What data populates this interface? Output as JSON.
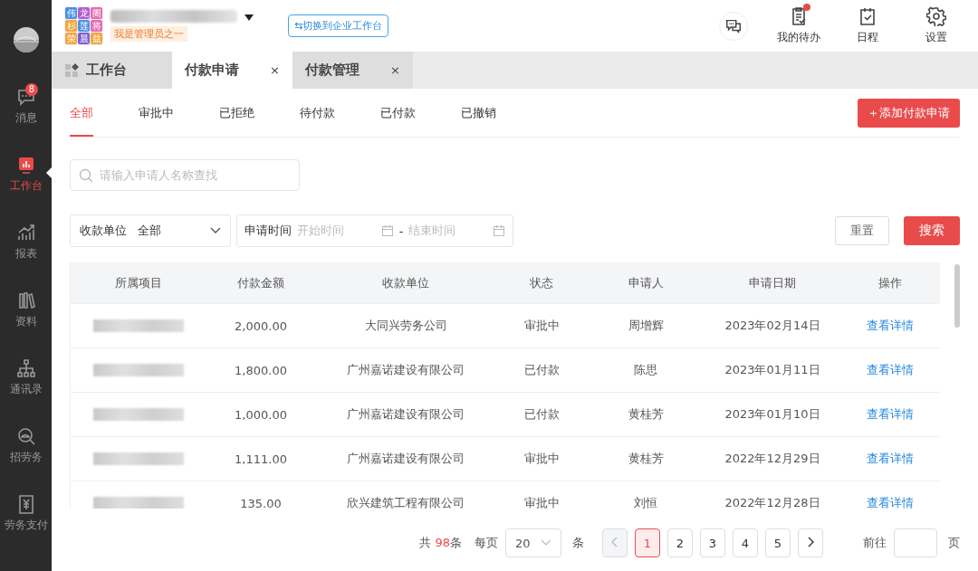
{
  "sidebar": {
    "items": [
      {
        "label": "消息",
        "badge": "8",
        "selected": false
      },
      {
        "label": "工作台",
        "selected": true
      },
      {
        "label": "报表",
        "selected": false
      },
      {
        "label": "资料",
        "selected": false
      },
      {
        "label": "通讯录",
        "selected": false
      },
      {
        "label": "招劳务",
        "selected": false
      },
      {
        "label": "劳务支付",
        "selected": false
      }
    ]
  },
  "header": {
    "logo_chars": [
      "伟",
      "龙",
      "阁",
      "杉",
      "莲",
      "将",
      "荣",
      "晨",
      "益"
    ],
    "role_badge": "我是管理员之一",
    "switch_button": "⇆切换到企业工作台",
    "actions": [
      {
        "kind": "chat"
      },
      {
        "kind": "todo",
        "label": "我的待办",
        "notify": true
      },
      {
        "kind": "calendar",
        "label": "日程",
        "notify": false
      },
      {
        "kind": "gear",
        "label": "设置",
        "notify": false
      }
    ]
  },
  "page_tabs": [
    {
      "label": "工作台",
      "kind": "home",
      "selected": false
    },
    {
      "label": "付款申请",
      "kind": "closable",
      "close": "×",
      "selected": true
    },
    {
      "label": "付款管理",
      "kind": "closable",
      "close": "×",
      "selected": false
    }
  ],
  "status_tabs": [
    {
      "label": "全部",
      "selected": true
    },
    {
      "label": "审批中",
      "selected": false
    },
    {
      "label": "已拒绝",
      "selected": false
    },
    {
      "label": "待付款",
      "selected": false
    },
    {
      "label": "已付款",
      "selected": false
    },
    {
      "label": "已撤销",
      "selected": false
    }
  ],
  "add_button": "＋添加付款申请",
  "search": {
    "placeholder": "请输入申请人名称查找"
  },
  "filters": {
    "payee": {
      "label": "收款单位",
      "value": "全部"
    },
    "date": {
      "label": "申请时间",
      "start_placeholder": "开始时间",
      "separator": "-",
      "end_placeholder": "结束时间"
    },
    "reset": "重置",
    "search": "搜索"
  },
  "table": {
    "columns": [
      "所属项目",
      "付款金额",
      "收款单位",
      "状态",
      "申请人",
      "申请日期",
      "操作"
    ],
    "rows": [
      {
        "amount": "2,000.00",
        "payee": "大同兴劳务公司",
        "status": "审批中",
        "applicant": "周增辉",
        "date": "2023年02月14日",
        "action": "查看详情"
      },
      {
        "amount": "1,800.00",
        "payee": "广州嘉诺建设有限公司",
        "status": "已付款",
        "applicant": "陈思",
        "date": "2023年01月11日",
        "action": "查看详情"
      },
      {
        "amount": "1,000.00",
        "payee": "广州嘉诺建设有限公司",
        "status": "已付款",
        "applicant": "黄桂芳",
        "date": "2023年01月10日",
        "action": "查看详情"
      },
      {
        "amount": "1,111.00",
        "payee": "广州嘉诺建设有限公司",
        "status": "审批中",
        "applicant": "黄桂芳",
        "date": "2022年12月29日",
        "action": "查看详情"
      },
      {
        "amount": "135.00",
        "payee": "欣兴建筑工程有限公司",
        "status": "审批中",
        "applicant": "刘恒",
        "date": "2022年12月28日",
        "action": "查看详情"
      }
    ]
  },
  "pagination": {
    "total_prefix": "共",
    "total": "98",
    "total_suffix": "条",
    "per_page_label": "每页",
    "per_page": "20",
    "per_page_unit": "条",
    "prev_disabled": true,
    "pages": [
      {
        "label": "1",
        "selected": true
      },
      {
        "label": "2",
        "selected": false
      },
      {
        "label": "3",
        "selected": false
      },
      {
        "label": "4",
        "selected": false
      },
      {
        "label": "5",
        "selected": false
      }
    ],
    "goto_label": "前往",
    "goto_unit": "页"
  }
}
